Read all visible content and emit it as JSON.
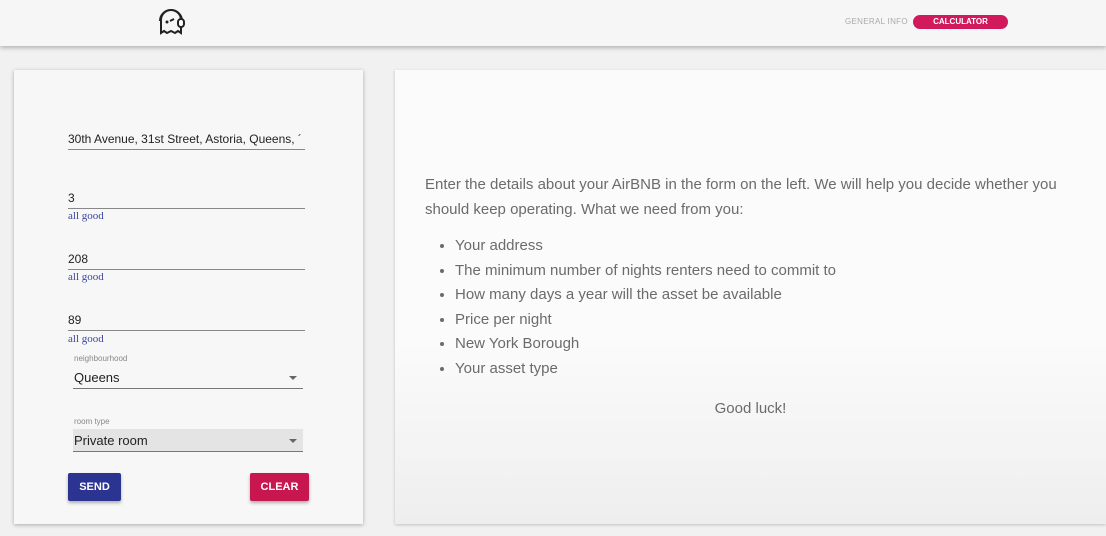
{
  "nav": {
    "general_info": "GENERAL INFO",
    "calculator": "CALCULATOR",
    "accent": "#d01a5c"
  },
  "form": {
    "address": "30th Avenue, 31st Street, Astoria, Queens, ´",
    "min_nights": "3",
    "min_nights_hint": "all good",
    "availability": "208",
    "availability_hint": "all good",
    "price": "89",
    "price_hint": "all good",
    "neighbourhood_label": "neighbourhood",
    "neighbourhood": "Queens",
    "room_type_label": "room type",
    "room_type": "Private room",
    "send": "SEND",
    "clear": "CLEAR"
  },
  "info": {
    "intro": "Enter the details about your AirBNB in the form on the left. We will help you decide whether you should keep operating. What we need from you:",
    "items": [
      "Your address",
      "The minimum number of nights renters need to commit to",
      "How many days a year will the asset be available",
      "Price per night",
      "New York Borough",
      "Your asset type"
    ],
    "closing": "Good luck!"
  }
}
